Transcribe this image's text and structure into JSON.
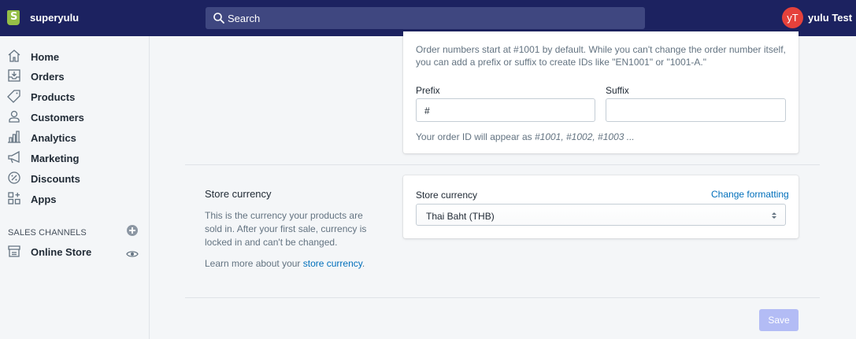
{
  "header": {
    "store_name": "superyulu",
    "logo_letter": "S",
    "search_placeholder": "Search",
    "avatar_initials": "yT",
    "user_name": "yulu Test",
    "bar_color": "#1c2260",
    "avatar_color": "#e5413b"
  },
  "sidebar": {
    "items": [
      {
        "label": "Home",
        "icon": "home-icon"
      },
      {
        "label": "Orders",
        "icon": "orders-icon"
      },
      {
        "label": "Products",
        "icon": "tag-icon"
      },
      {
        "label": "Customers",
        "icon": "person-icon"
      },
      {
        "label": "Analytics",
        "icon": "bar-chart-icon"
      },
      {
        "label": "Marketing",
        "icon": "megaphone-icon"
      },
      {
        "label": "Discounts",
        "icon": "discount-icon"
      },
      {
        "label": "Apps",
        "icon": "apps-icon"
      }
    ],
    "channels_title": "SALES CHANNELS",
    "channel_item": {
      "label": "Online Store",
      "icon": "store-icon"
    }
  },
  "order_id": {
    "description": "Order numbers start at #1001 by default. While you can't change the order number itself, you can add a prefix or suffix to create IDs like \"EN1001\" or \"1001-A.\"",
    "prefix_label": "Prefix",
    "prefix_value": "#",
    "suffix_label": "Suffix",
    "suffix_value": "",
    "preview_text": "Your order ID will appear as ",
    "preview_ids": "#1001, #1002, #1003 ..."
  },
  "currency": {
    "section_title": "Store currency",
    "section_desc": "This is the currency your products are sold in. After your first sale, currency is locked in and can't be changed.",
    "learn_prefix": "Learn more about your ",
    "learn_link": "store currency",
    "learn_suffix": ".",
    "field_label": "Store currency",
    "change_formatting": "Change formatting",
    "selected_value": "Thai Baht (THB)"
  },
  "footer": {
    "save_label": "Save",
    "save_color": "#b3bcf5"
  }
}
